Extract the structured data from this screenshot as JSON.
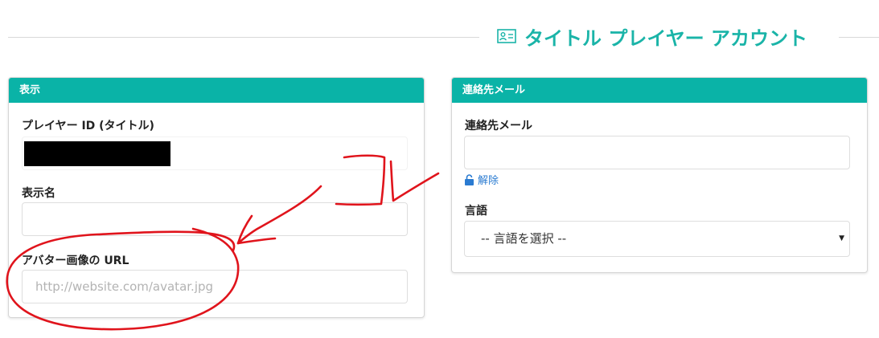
{
  "header": {
    "title": "タイトル プレイヤー アカウント",
    "icon": "id-card-icon",
    "accent_color": "#1ab4a8"
  },
  "display_panel": {
    "heading": "表示",
    "player_id_label": "プレイヤー ID (タイトル)",
    "display_name_label": "表示名",
    "display_name_value": "",
    "avatar_url_label": "アバター画像の URL",
    "avatar_url_placeholder": "http://website.com/avatar.jpg"
  },
  "contact_panel": {
    "heading": "連絡先メール",
    "email_label": "連絡先メール",
    "email_value": "",
    "unlock_label": "解除",
    "language_label": "言語",
    "language_selected": "-- 言語を選択 --"
  },
  "colors": {
    "panel_header": "#0ab3a7",
    "link": "#2a7bd1",
    "annotation": "#e0141c"
  }
}
